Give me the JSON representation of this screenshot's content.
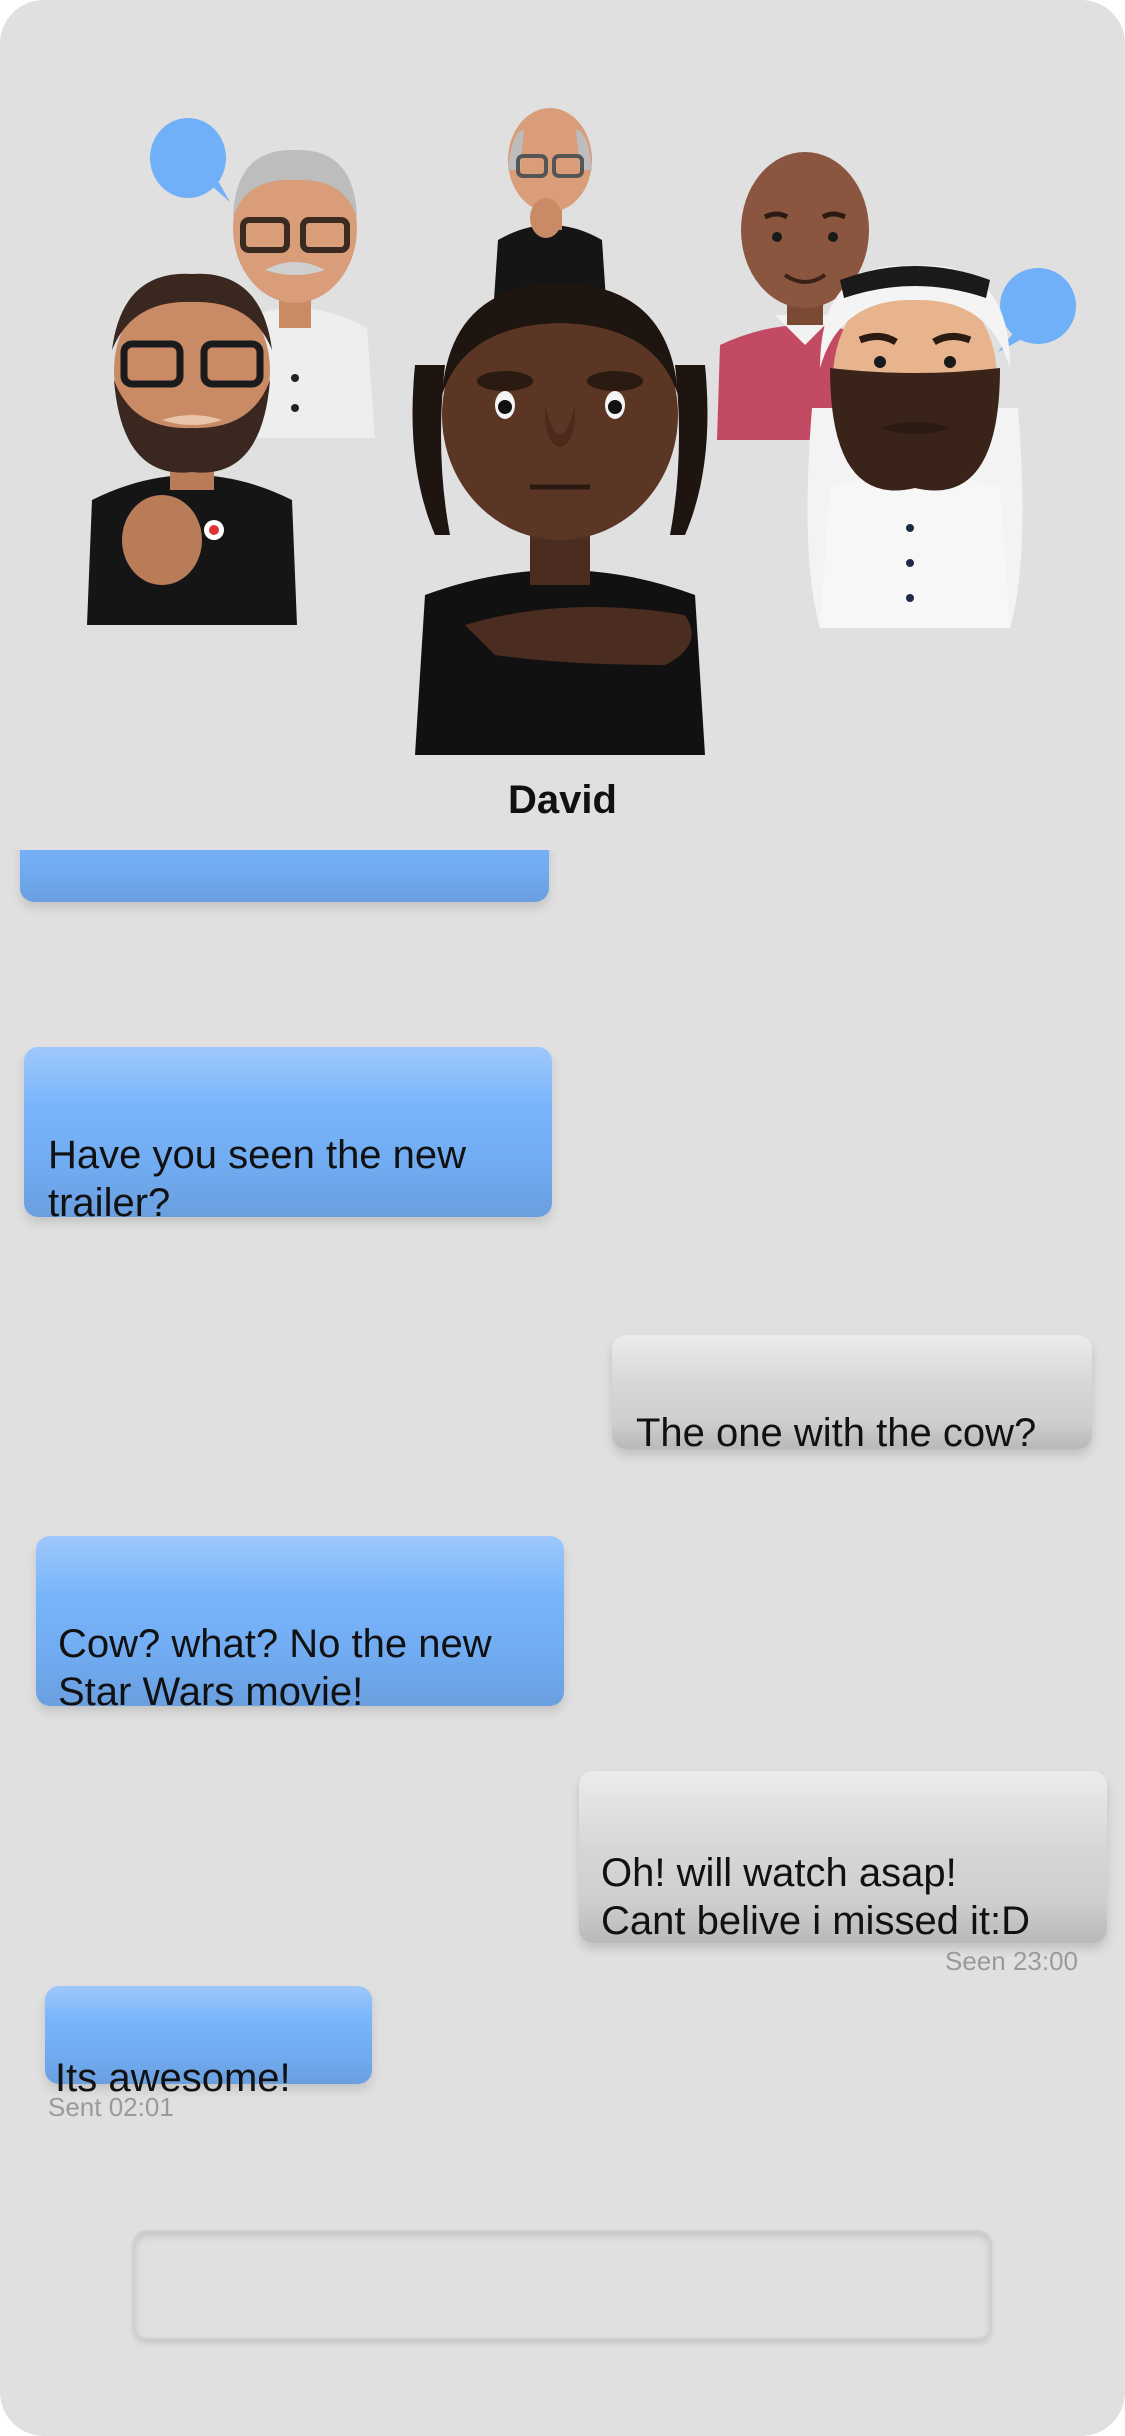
{
  "contact": {
    "name": "David"
  },
  "messages": [
    {
      "direction": "in",
      "text": ""
    },
    {
      "direction": "in",
      "text": "Have you seen the new\ntrailer?"
    },
    {
      "direction": "out",
      "text": "The one with the cow?"
    },
    {
      "direction": "in",
      "text": "Cow? what? No the new\nStar Wars movie!"
    },
    {
      "direction": "out",
      "text": "Oh! will watch asap!\nCant belive i missed it:D",
      "status": "Seen 23:00"
    },
    {
      "direction": "in",
      "text": "Its awesome!",
      "status": "Sent 02:01"
    }
  ],
  "composer": {
    "value": "",
    "placeholder": ""
  },
  "colors": {
    "background": "#e0e0e0",
    "incoming_bubble": "#78b4fb",
    "outgoing_bubble": "#d4d4d4",
    "speech_bubble_icon": "#6fb0f9",
    "meta_text": "#9a9a9a"
  },
  "icons": [
    "speech-bubble-icon",
    "speech-bubble-icon"
  ]
}
